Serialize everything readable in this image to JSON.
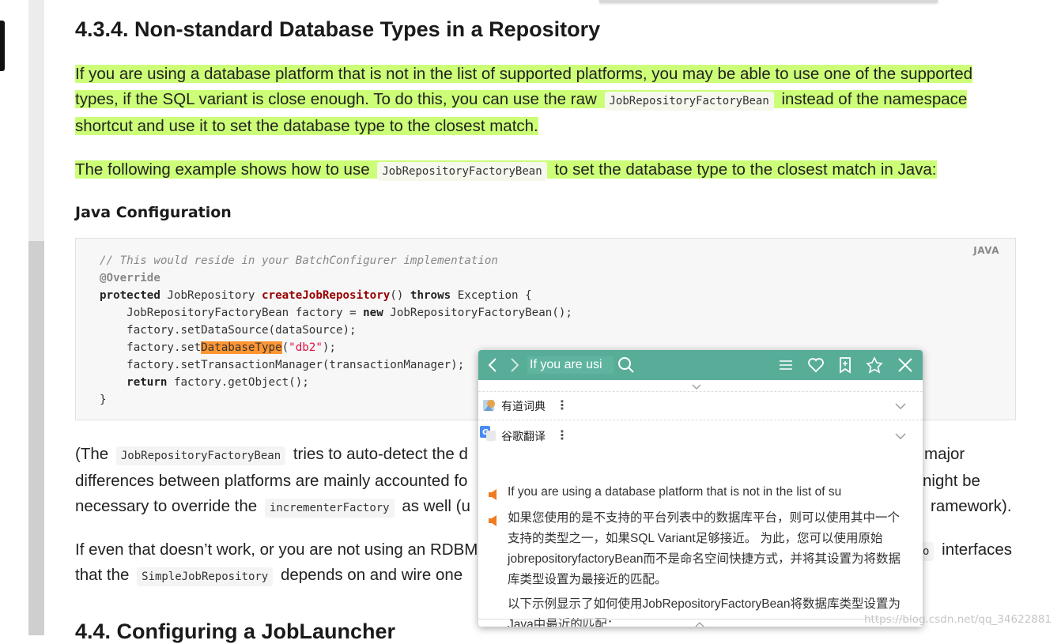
{
  "section": {
    "title": "4.3.4. Non-standard Database Types in a Repository",
    "next_title": "4.4. Configuring a JobLauncher"
  },
  "para1": {
    "text_a": "If you are using a database platform that is not in the list of supported platforms, you may be able to use one of the supported",
    "text_b": "types, if the SQL variant is close enough. To do this, you can use the raw",
    "code": "JobRepositoryFactoryBean",
    "text_c": "instead of the namespace",
    "text_d": "shortcut and use it to set the database type to the closest match."
  },
  "para2": {
    "text_a": "The following example shows how to use",
    "code": "JobRepositoryFactoryBean",
    "text_b": "to set the database type to the closest match in Java:"
  },
  "java_config": {
    "heading": "Java Configuration",
    "lang": "JAVA",
    "lines": {
      "l1": "// This would reside in your BatchConfigurer implementation",
      "l2": "@Override",
      "l3_kw": "protected",
      "l3_a": " JobRepository ",
      "l3_fn": "createJobRepository",
      "l3_b": "() ",
      "l3_kw2": "throws",
      "l3_c": " Exception {",
      "l4_a": "    JobRepositoryFactoryBean factory = ",
      "l4_kw": "new",
      "l4_b": " JobRepositoryFactoryBean();",
      "l5": "    factory.setDataSource(dataSource);",
      "l6_a": "    factory.set",
      "l6_mark": "DatabaseType",
      "l6_b": "(",
      "l6_str": "\"db2\"",
      "l6_c": ");",
      "l7": "    factory.setTransactionManager(transactionManager);",
      "l8_kw": "    return",
      "l8_a": " factory.getObject();",
      "l9": "}"
    }
  },
  "para3": {
    "line1_a": "(The",
    "line1_code": "JobRepositoryFactoryBean",
    "line1_b": "tries to auto-detect the d",
    "line1_c": "major",
    "line2_a": "differences between platforms are mainly accounted fo",
    "line2_b": "night be",
    "line3_a": "necessary to override the",
    "line3_code": "incrementerFactory",
    "line3_b": "as well (u",
    "line3_c": "ramework)."
  },
  "para4": {
    "line1_a": "If even that doesn’t work, or you are not using an RDBM",
    "line1_code": "o",
    "line1_b": "interfaces",
    "line2_a": "that the",
    "line2_code": "SimpleJobRepository",
    "line2_b": "depends on and wire one"
  },
  "popup": {
    "query": "If you are usi",
    "sources": {
      "youdao": "有道词典",
      "google": "谷歌翻译"
    },
    "en_line": "If you are using a database platform that is not in the list of su",
    "zh1": "如果您使用的是不支持的平台列表中的数据库平台，则可以使用其中一个支持的类型之一，如果SQL Variant足够接近。 为此，您可以使用原始jobrepositoryfactoryBean而不是命名空间快捷方式，并将其设置为将数据库类型设置为最接近的匹配。",
    "zh2": "以下示例显示了如何使用JobRepositoryFactoryBean将数据库类型设置为Java中最近的匹配："
  },
  "watermark": "https://blog.csdn.net/qq_34622881",
  "colors": {
    "highlight": "#ccff77",
    "popup_header": "#58ad99",
    "mark": "#ff9632"
  }
}
